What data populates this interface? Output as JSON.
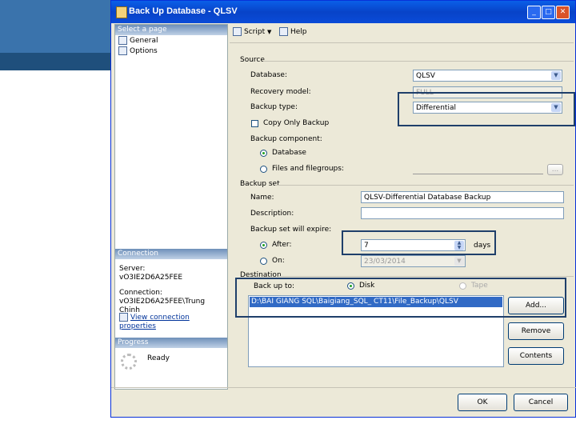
{
  "window": {
    "title": "Back Up Database - QLSV",
    "minimize": "_",
    "maximize": "□",
    "close": "✕"
  },
  "left": {
    "select_page": "Select a page",
    "pages": [
      "General",
      "Options"
    ],
    "connection_header": "Connection",
    "server_label": "Server:",
    "server_value": "vO3IE2D6A25FEE",
    "connection_label": "Connection:",
    "connection_value": "vO3IE2D6A25FEE\\Trung Chinh",
    "view_link": "View connection properties",
    "progress_header": "Progress",
    "progress_status": "Ready"
  },
  "toolbar": {
    "script": "Script",
    "help": "Help",
    "dropdown": "▼"
  },
  "source": {
    "header": "Source",
    "database_label": "Database:",
    "database_value": "QLSV",
    "recovery_label": "Recovery model:",
    "recovery_value": "FULL",
    "backup_type_label": "Backup type:",
    "backup_type_value": "Differential",
    "copy_only": "Copy Only Backup",
    "component_label": "Backup component:",
    "comp_database": "Database",
    "comp_files": "Files and filegroups:",
    "browse": "..."
  },
  "backup_set": {
    "header": "Backup set",
    "name_label": "Name:",
    "name_value": "QLSV-Differential Database Backup",
    "description_label": "Description:",
    "expire_label": "Backup set will expire:",
    "after_label": "After:",
    "after_value": "7",
    "days": "days",
    "on_label": "On:",
    "on_value": "23/03/2014"
  },
  "destination": {
    "header": "Destination",
    "backup_to": "Back up to:",
    "disk": "Disk",
    "tape": "Tape",
    "path": "D:\\BAI GIANG SQL\\Baigiang_SQL_ CT11\\File_Backup\\QLSV"
  },
  "buttons": {
    "add": "Add...",
    "remove": "Remove",
    "contents": "Contents",
    "ok": "OK",
    "cancel": "Cancel"
  }
}
